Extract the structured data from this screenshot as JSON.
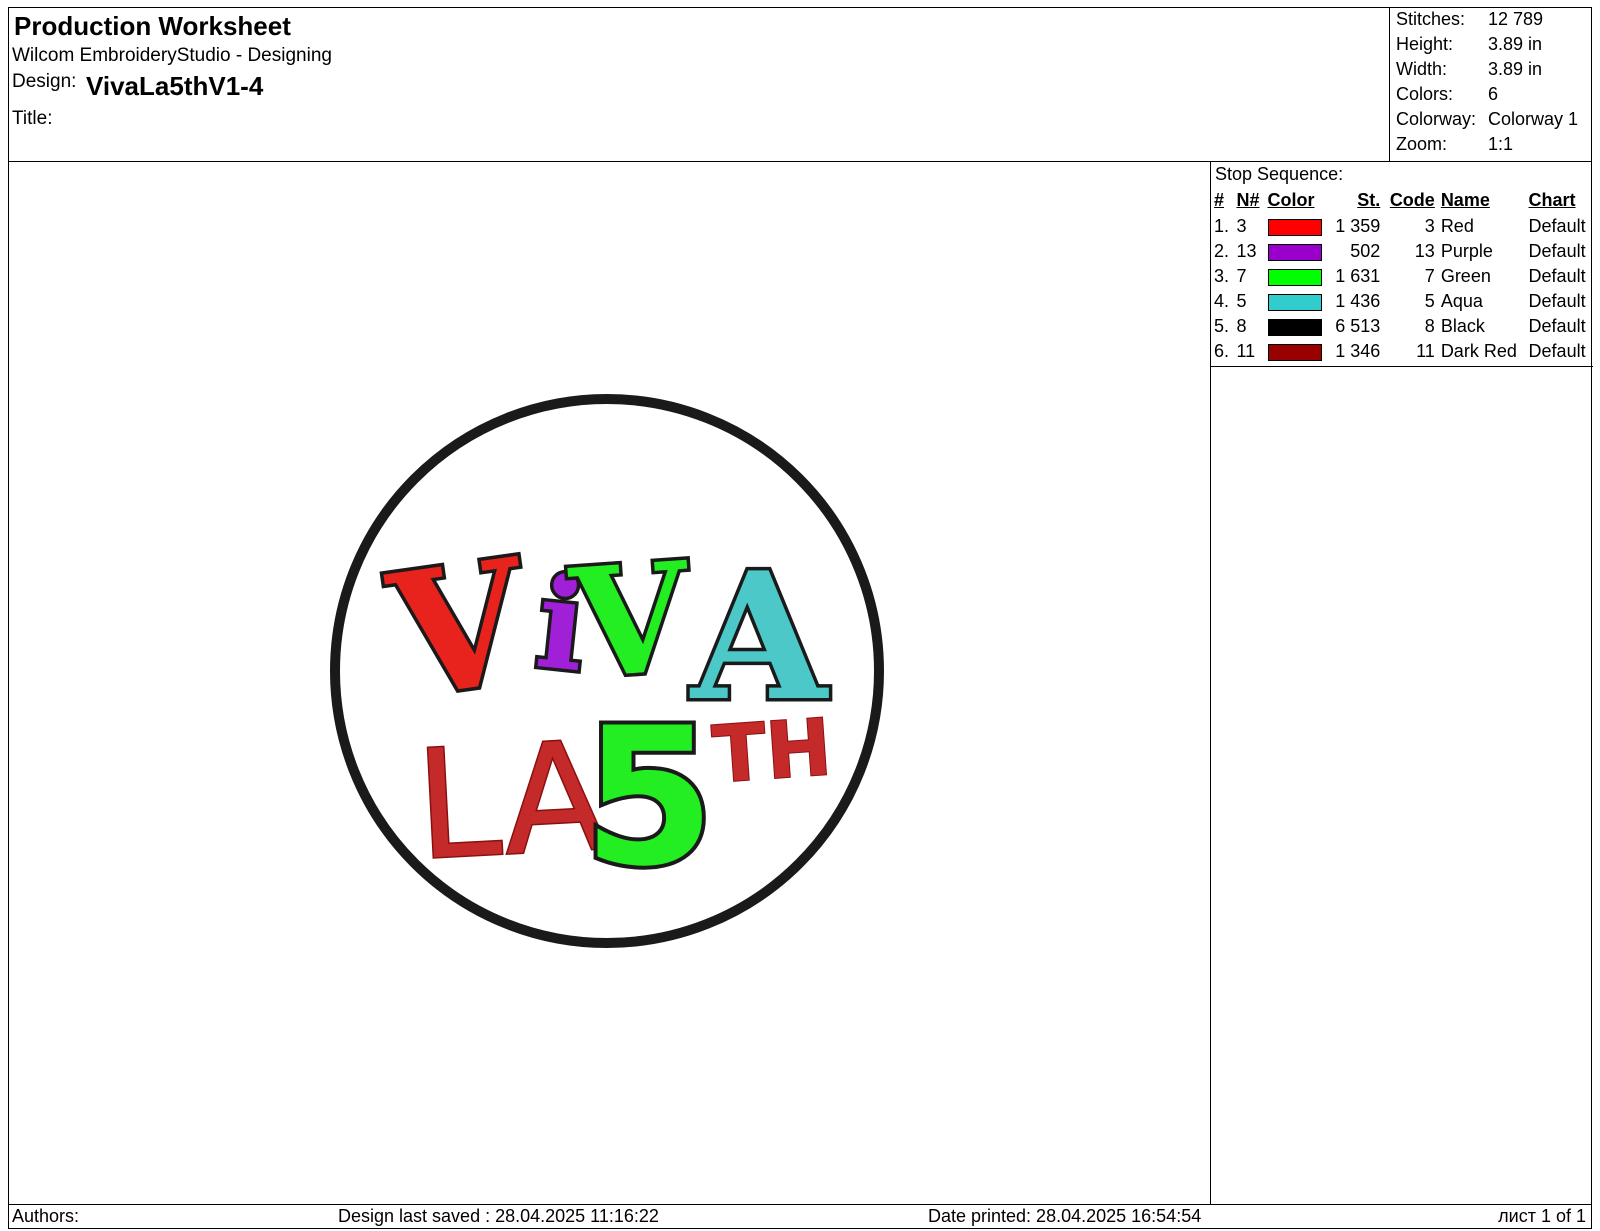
{
  "header": {
    "worksheet_title": "Production Worksheet",
    "software": "Wilcom EmbroideryStudio - Designing",
    "design_label": "Design:",
    "design_name": "VivaLa5thV1-4",
    "title_label": "Title:"
  },
  "stats": [
    {
      "key": "Stitches:",
      "value": "12 789"
    },
    {
      "key": "Height:",
      "value": "3.89 in"
    },
    {
      "key": "Width:",
      "value": "3.89 in"
    },
    {
      "key": "Colors:",
      "value": "6"
    },
    {
      "key": "Colorway:",
      "value": "Colorway 1"
    },
    {
      "key": "Zoom:",
      "value": "1:1"
    }
  ],
  "stop_sequence": {
    "title": "Stop Sequence:",
    "headers": {
      "num": "#",
      "n": "N#",
      "color": "Color",
      "st": "St.",
      "code": "Code",
      "name": "Name",
      "chart": "Chart"
    },
    "rows": [
      {
        "num": "1.",
        "n": "3",
        "color": "#ff0000",
        "st": "1 359",
        "code": "3",
        "name": "Red",
        "chart": "Default"
      },
      {
        "num": "2.",
        "n": "13",
        "color": "#9900cc",
        "st": "502",
        "code": "13",
        "name": "Purple",
        "chart": "Default"
      },
      {
        "num": "3.",
        "n": "7",
        "color": "#00ff00",
        "st": "1 631",
        "code": "7",
        "name": "Green",
        "chart": "Default"
      },
      {
        "num": "4.",
        "n": "5",
        "color": "#33cccc",
        "st": "1 436",
        "code": "5",
        "name": "Aqua",
        "chart": "Default"
      },
      {
        "num": "5.",
        "n": "8",
        "color": "#000000",
        "st": "6 513",
        "code": "8",
        "name": "Black",
        "chart": "Default"
      },
      {
        "num": "6.",
        "n": "11",
        "color": "#990000",
        "st": "1 346",
        "code": "11",
        "name": "Dark Red",
        "chart": "Default"
      }
    ]
  },
  "design_preview": {
    "letters": [
      "V",
      "i",
      "V",
      "A",
      "LA",
      "5",
      "TH"
    ],
    "colors": {
      "red": "#e8231e",
      "purple": "#a020d8",
      "green": "#22ee22",
      "aqua": "#4cc8c8",
      "black": "#1a1a1a",
      "dark_red": "#c42a2a"
    }
  },
  "footer": {
    "authors": "Authors:",
    "last_saved": "Design last saved : 28.04.2025 11:16:22",
    "printed": "Date printed: 28.04.2025 16:54:54",
    "page": "лист 1 of 1"
  }
}
